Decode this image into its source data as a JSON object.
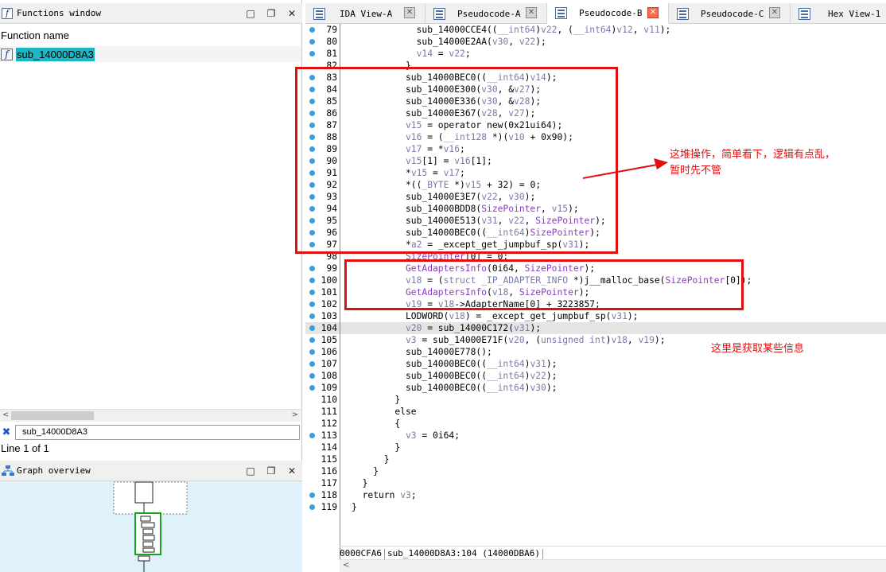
{
  "functions_window": {
    "title": "Functions window",
    "column_header": "Function name",
    "function_item": "sub_14000D8A3",
    "filter_value": "sub_14000D8A3",
    "status": "Line 1 of 1"
  },
  "graph_overview": {
    "title": "Graph overview"
  },
  "tabs": [
    {
      "label": "IDA View-A",
      "active": false
    },
    {
      "label": "Pseudocode-A",
      "active": false
    },
    {
      "label": "Pseudocode-B",
      "active": true
    },
    {
      "label": "Pseudocode-C",
      "active": false
    },
    {
      "label": "Hex View-1",
      "active": false
    }
  ],
  "code_lines": [
    {
      "n": "79",
      "dot": true,
      "text": "sub_14000CCE4((__int64)v22, (__int64)v12, v11);",
      "indent": 12
    },
    {
      "n": "80",
      "dot": true,
      "text": "sub_14000E2AA(v30, v22);",
      "indent": 12
    },
    {
      "n": "81",
      "dot": true,
      "text": "v14 = v22;",
      "indent": 12
    },
    {
      "n": "82",
      "dot": false,
      "text": "}",
      "indent": 10
    },
    {
      "n": "83",
      "dot": true,
      "text": "sub_14000BEC0((__int64)v14);",
      "indent": 10
    },
    {
      "n": "84",
      "dot": true,
      "text": "sub_14000E300(v30, &v27);",
      "indent": 10
    },
    {
      "n": "85",
      "dot": true,
      "text": "sub_14000E336(v30, &v28);",
      "indent": 10
    },
    {
      "n": "86",
      "dot": true,
      "text": "sub_14000E367(v28, v27);",
      "indent": 10
    },
    {
      "n": "87",
      "dot": true,
      "text": "v15 = operator new(0x21ui64);",
      "indent": 10
    },
    {
      "n": "88",
      "dot": true,
      "text": "v16 = (__int128 *)(v10 + 0x90);",
      "indent": 10
    },
    {
      "n": "89",
      "dot": true,
      "text": "v17 = *v16;",
      "indent": 10
    },
    {
      "n": "90",
      "dot": true,
      "text": "v15[1] = v16[1];",
      "indent": 10
    },
    {
      "n": "91",
      "dot": true,
      "text": "*v15 = v17;",
      "indent": 10
    },
    {
      "n": "92",
      "dot": true,
      "text": "*((_BYTE *)v15 + 32) = 0;",
      "indent": 10
    },
    {
      "n": "93",
      "dot": true,
      "text": "sub_14000E3E7(v22, v30);",
      "indent": 10
    },
    {
      "n": "94",
      "dot": true,
      "text": "sub_14000BDD8(SizePointer, v15);",
      "indent": 10
    },
    {
      "n": "95",
      "dot": true,
      "text": "sub_14000E513(v31, v22, SizePointer);",
      "indent": 10
    },
    {
      "n": "96",
      "dot": true,
      "text": "sub_14000BEC0((__int64)SizePointer);",
      "indent": 10
    },
    {
      "n": "97",
      "dot": true,
      "text": "*a2 = _except_get_jumpbuf_sp(v31);",
      "indent": 10
    },
    {
      "n": "98",
      "dot": false,
      "text": "SizePointer[0] = 0;",
      "indent": 10
    },
    {
      "n": "99",
      "dot": true,
      "text": "GetAdaptersInfo(0i64, SizePointer);",
      "indent": 10
    },
    {
      "n": "100",
      "dot": true,
      "text": "v18 = (struct _IP_ADAPTER_INFO *)j__malloc_base(SizePointer[0]);",
      "indent": 10
    },
    {
      "n": "101",
      "dot": true,
      "text": "GetAdaptersInfo(v18, SizePointer);",
      "indent": 10
    },
    {
      "n": "102",
      "dot": true,
      "text": "v19 = v18->AdapterName[0] + 3223857;",
      "indent": 10
    },
    {
      "n": "103",
      "dot": true,
      "text": "LODWORD(v18) = _except_get_jumpbuf_sp(v31);",
      "indent": 10
    },
    {
      "n": "104",
      "dot": true,
      "text": "v20 = sub_14000C172(v31);",
      "indent": 10,
      "current": true
    },
    {
      "n": "105",
      "dot": true,
      "text": "v3 = sub_14000E71F(v20, (unsigned int)v18, v19);",
      "indent": 10
    },
    {
      "n": "106",
      "dot": true,
      "text": "sub_14000E778();",
      "indent": 10
    },
    {
      "n": "107",
      "dot": true,
      "text": "sub_14000BEC0((__int64)v31);",
      "indent": 10
    },
    {
      "n": "108",
      "dot": true,
      "text": "sub_14000BEC0((__int64)v22);",
      "indent": 10
    },
    {
      "n": "109",
      "dot": true,
      "text": "sub_14000BEC0((__int64)v30);",
      "indent": 10
    },
    {
      "n": "110",
      "dot": false,
      "text": "}",
      "indent": 8
    },
    {
      "n": "111",
      "dot": false,
      "text": "else",
      "indent": 8
    },
    {
      "n": "112",
      "dot": false,
      "text": "{",
      "indent": 8
    },
    {
      "n": "113",
      "dot": true,
      "text": "v3 = 0i64;",
      "indent": 10
    },
    {
      "n": "114",
      "dot": false,
      "text": "}",
      "indent": 8
    },
    {
      "n": "115",
      "dot": false,
      "text": "}",
      "indent": 6
    },
    {
      "n": "116",
      "dot": false,
      "text": "}",
      "indent": 4
    },
    {
      "n": "117",
      "dot": false,
      "text": "}",
      "indent": 2
    },
    {
      "n": "118",
      "dot": true,
      "text": "return v3;",
      "indent": 2
    },
    {
      "n": "119",
      "dot": true,
      "text": "}",
      "indent": 0
    }
  ],
  "annotations": {
    "note1_line1": "这堆操作，简单看下，逻辑有点乱，",
    "note1_line2": "暂时先不管",
    "note2": "这里是获取某些信息"
  },
  "status_bar": {
    "address": "0000CFA6",
    "location": "sub_14000D8A3:104 (14000DBA6)"
  },
  "colors": {
    "highlight_function": "#1cb7c4",
    "annotation": "#e01010",
    "breakpoint_dot": "#3b9de0",
    "api_purple": "#8a3cbf",
    "variable_gray": "#7a7aa8"
  }
}
